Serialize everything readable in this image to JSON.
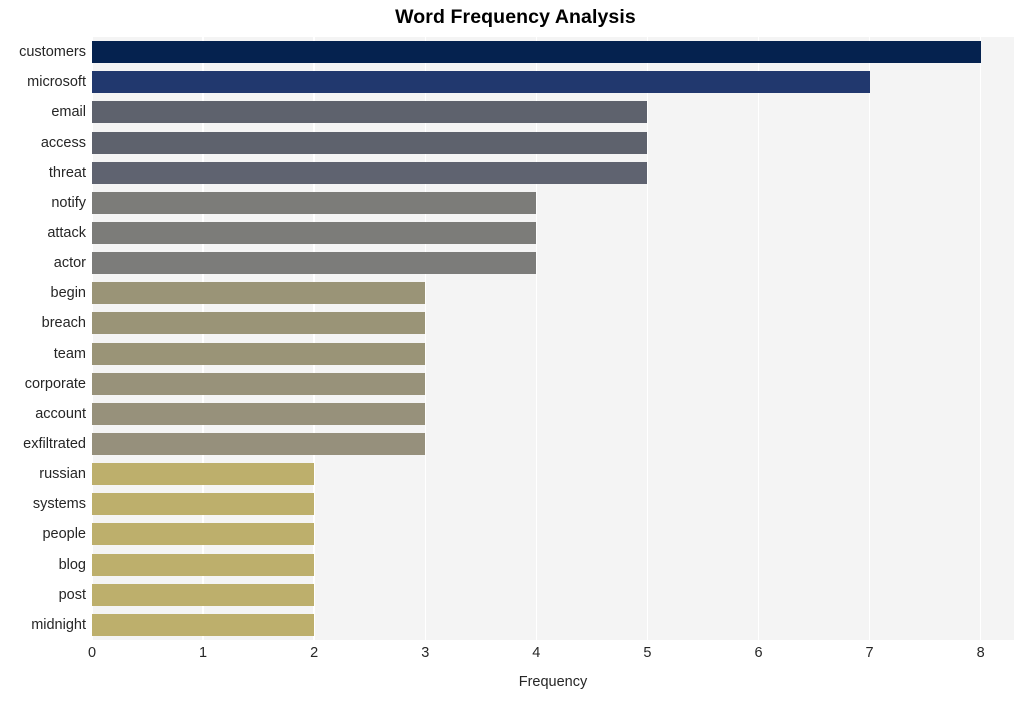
{
  "chart_data": {
    "type": "bar",
    "orientation": "horizontal",
    "title": "Word Frequency Analysis",
    "xlabel": "Frequency",
    "ylabel": "",
    "xlim": [
      0,
      8.3
    ],
    "xticks": [
      "0",
      "1",
      "2",
      "3",
      "4",
      "5",
      "6",
      "7",
      "8"
    ],
    "xtick_values": [
      0,
      1,
      2,
      3,
      4,
      5,
      6,
      7,
      8
    ],
    "grid": "vertical-white-on-gray",
    "legend": "none",
    "categories": [
      "customers",
      "microsoft",
      "email",
      "access",
      "threat",
      "notify",
      "attack",
      "actor",
      "begin",
      "breach",
      "team",
      "corporate",
      "account",
      "exfiltrated",
      "russian",
      "systems",
      "people",
      "blog",
      "post",
      "midnight"
    ],
    "values": [
      8,
      7,
      5,
      5,
      5,
      4,
      4,
      4,
      3,
      3,
      3,
      3,
      3,
      3,
      2,
      2,
      2,
      2,
      2,
      2
    ],
    "bar_colors": [
      "#05224f",
      "#21386e",
      "#5e626d",
      "#5e626d",
      "#5f6370",
      "#7c7c79",
      "#7c7c79",
      "#7c7c7a",
      "#9a9477",
      "#9a9477",
      "#9a9477",
      "#98927a",
      "#97917b",
      "#96907c",
      "#bdaf6c",
      "#bdaf6c",
      "#bdaf6c",
      "#bdaf6c",
      "#bdaf6c",
      "#bdaf6c"
    ]
  },
  "style": {
    "plot_background": "#f4f4f4",
    "grid_color": "#ffffff",
    "figure_background": "#ffffff",
    "text_color": "#262626"
  }
}
